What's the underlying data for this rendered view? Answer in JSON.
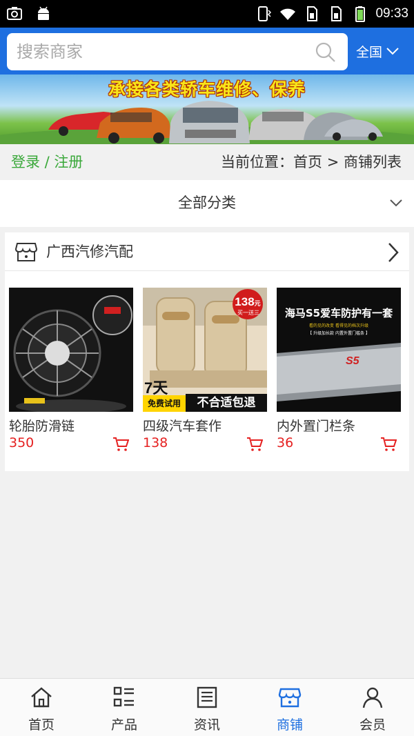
{
  "status_bar": {
    "time": "09:33"
  },
  "search": {
    "placeholder": "搜索商家",
    "value": ""
  },
  "region": {
    "label": "全国"
  },
  "banner": {
    "text": "承接各类轿车维修、保养"
  },
  "nav": {
    "login": "登录 / 注册",
    "breadcrumb": "当前位置：首页 > 商铺列表"
  },
  "category": {
    "label": "全部分类"
  },
  "shop": {
    "name": "广西汽修汽配",
    "products": [
      {
        "name": "轮胎防滑链",
        "price": "350"
      },
      {
        "name": "四级汽车套作",
        "price": "138",
        "badge_price": "138",
        "badge_unit": "元",
        "badge_sub": "买一送三",
        "badge_days": "7天",
        "badge_trial": "免费试用",
        "badge_return": "不合适包退"
      },
      {
        "name": "内外置门栏条",
        "price": "36",
        "title": "海马S5爱车防护有一套",
        "sub1": "看的见的改变 看得见的档次升级",
        "sub2": "【 升级加长款 内置外置门槛条 】",
        "plate": "S5"
      }
    ]
  },
  "tabs": [
    {
      "label": "首页",
      "icon": "home-icon"
    },
    {
      "label": "产品",
      "icon": "list-icon"
    },
    {
      "label": "资讯",
      "icon": "news-icon"
    },
    {
      "label": "商铺",
      "icon": "shop-icon",
      "active": true
    },
    {
      "label": "会员",
      "icon": "user-icon"
    }
  ],
  "colors": {
    "brand": "#1e6fe0",
    "price": "#e52020",
    "login": "#3aa83a"
  }
}
